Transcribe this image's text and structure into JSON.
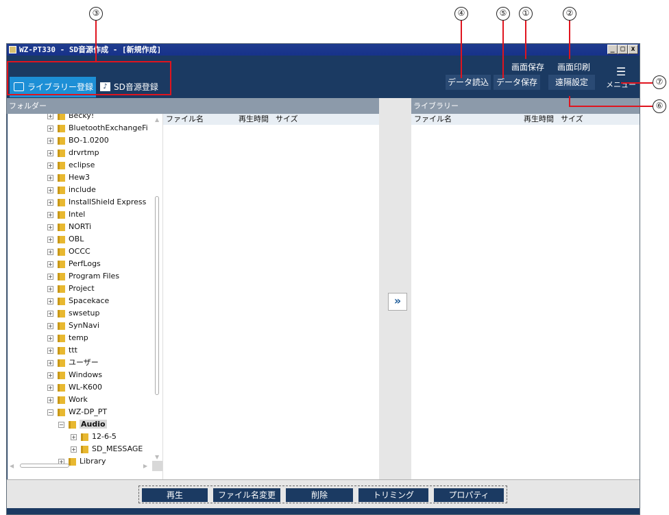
{
  "window": {
    "title": "WZ-PT330 - SD音源作成 - [新規作成]",
    "controls": [
      "_",
      "□",
      "x"
    ]
  },
  "callouts": [
    "①",
    "②",
    "③",
    "④",
    "⑤",
    "⑥",
    "⑦"
  ],
  "tabs": {
    "library": "ライブラリー登録",
    "sd": "SD音源登録"
  },
  "toolbar": {
    "screen_save": "画面保存",
    "screen_print": "画面印刷",
    "data_load": "データ読込",
    "data_save": "データ保存",
    "remote_settings": "遠隔設定",
    "menu": "メニュー"
  },
  "folder_panel": {
    "header": "フォルダー"
  },
  "tree": [
    "Becky!",
    "BluetoothExchangeFi",
    "BO-1.0200",
    "drvrtmp",
    "eclipse",
    "Hew3",
    "include",
    "InstallShield Express",
    "Intel",
    "NORTi",
    "OBL",
    "OCCC",
    "PerfLogs",
    "Program Files",
    "Project",
    "Spacekace",
    "swsetup",
    "SynNavi",
    "temp",
    "ttt",
    "ユーザー",
    "Windows",
    "WL-K600",
    "Work",
    "WZ-DP_PT",
    "Audio",
    "12-6-5",
    "SD_MESSAGE",
    "Library"
  ],
  "file_list": {
    "col_name": "ファイル名",
    "col_time": "再生時間",
    "col_size": "サイズ"
  },
  "library_panel": {
    "header": "ライブラリー",
    "col_name": "ファイル名",
    "col_time": "再生時間",
    "col_size": "サイズ"
  },
  "transfer_button": "»",
  "bottom_buttons": {
    "play": "再生",
    "rename": "ファイル名変更",
    "delete": "削除",
    "trim": "トリミング",
    "properties": "プロパティ"
  }
}
